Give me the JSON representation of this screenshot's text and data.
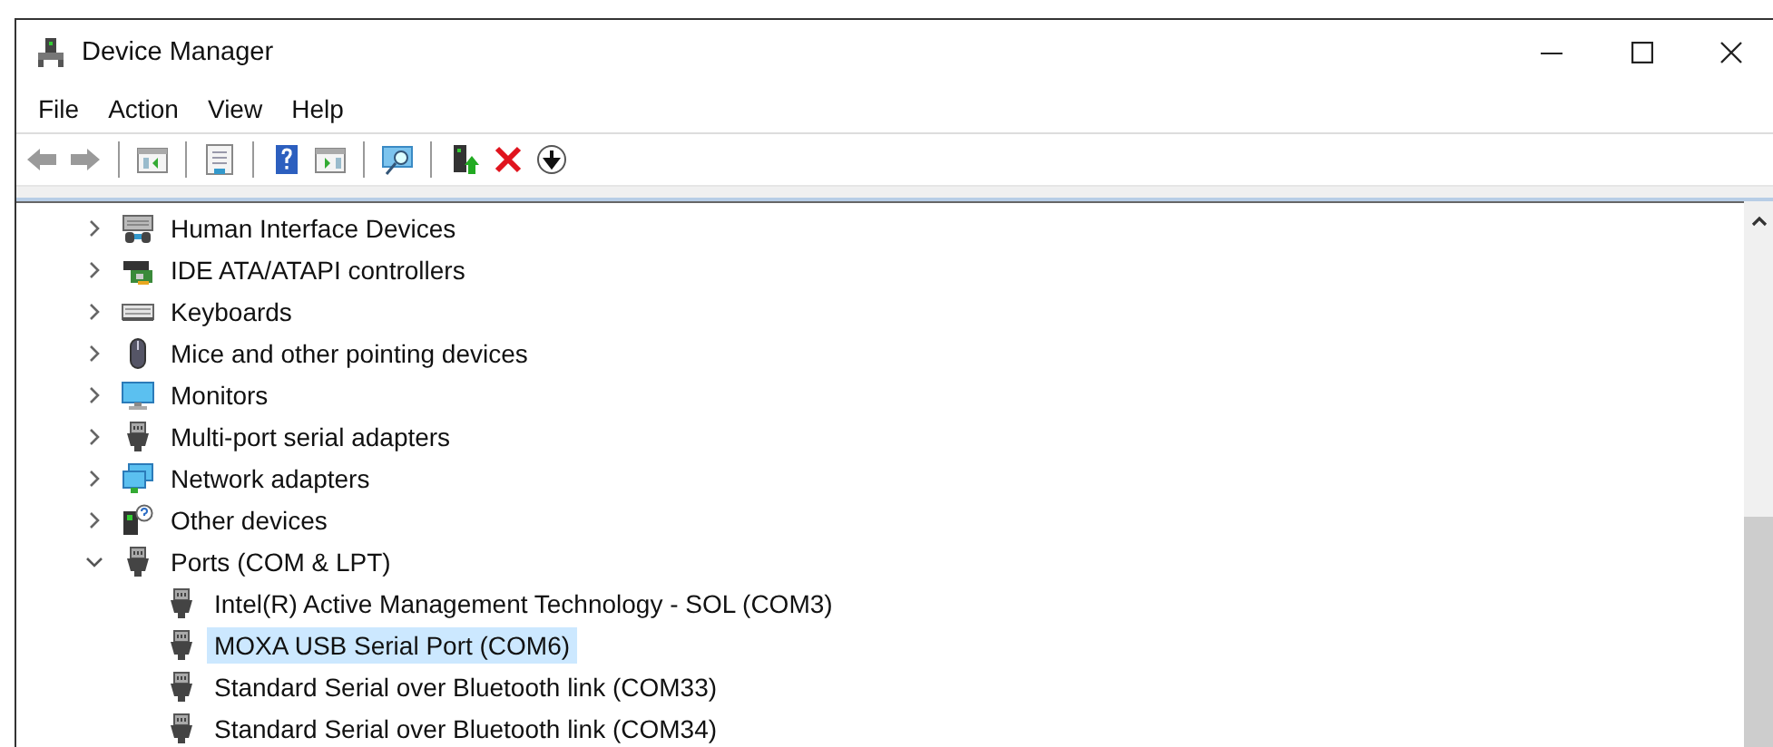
{
  "window": {
    "title": "Device Manager"
  },
  "menu": [
    "File",
    "Action",
    "View",
    "Help"
  ],
  "tree": [
    {
      "label": "Human Interface Devices",
      "kind": "hid",
      "expanded": false,
      "selected": false
    },
    {
      "label": "IDE ATA/ATAPI controllers",
      "kind": "ide",
      "expanded": false,
      "selected": false
    },
    {
      "label": "Keyboards",
      "kind": "keyboard",
      "expanded": false,
      "selected": false
    },
    {
      "label": "Mice and other pointing devices",
      "kind": "mouse",
      "expanded": false,
      "selected": false
    },
    {
      "label": "Monitors",
      "kind": "monitor",
      "expanded": false,
      "selected": false
    },
    {
      "label": "Multi-port serial adapters",
      "kind": "port",
      "expanded": false,
      "selected": false
    },
    {
      "label": "Network adapters",
      "kind": "network",
      "expanded": false,
      "selected": false
    },
    {
      "label": "Other devices",
      "kind": "other",
      "expanded": false,
      "selected": false
    },
    {
      "label": "Ports (COM & LPT)",
      "kind": "port",
      "expanded": true,
      "selected": false,
      "children": [
        {
          "label": "Intel(R) Active Management Technology - SOL (COM3)",
          "kind": "port",
          "selected": false
        },
        {
          "label": "MOXA USB Serial Port (COM6)",
          "kind": "port",
          "selected": true
        },
        {
          "label": "Standard Serial over Bluetooth link (COM33)",
          "kind": "port",
          "selected": false
        },
        {
          "label": "Standard Serial over Bluetooth link (COM34)",
          "kind": "port",
          "selected": false
        }
      ]
    }
  ]
}
